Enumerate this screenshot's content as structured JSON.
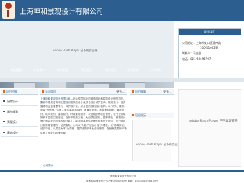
{
  "header": {
    "company_name": "上海坤和景观设计有限公司"
  },
  "banner": {
    "flash_notice": "Adobe Flash Player 已不再受支持"
  },
  "contact": {
    "title": "联系我们",
    "lines": [
      "公司地址：上海市虹口区通州路",
      "100号1002室",
      "联系人：马先生",
      "电话：021-26492767"
    ]
  },
  "nav": {
    "items": [
      "网站首页",
      "公司简介",
      "项目列表",
      "项目展示",
      "资质证书",
      "在线留言",
      "人才招聘"
    ]
  },
  "sidebar": {
    "title": "项目列表",
    "items": [
      "厨房设计",
      "城市规划",
      "景观设计",
      "建筑设计"
    ]
  },
  "about": {
    "title": "公司简介",
    "more": "更多...",
    "company_name": "上海坤和景观设计有限公司",
    "text": "—综合性国际化的城市规划和建筑设计研究机构，集城市规划咨询和工程设计服务的设计及综合设计研究咨询、规划设计、投资管理和运营管理等为一体的现代化、综合性的规划设计机构。以\"研究、服务、质量\"为宗旨，公司主要从事城市规划、风景区规划、旅游策划规划、景观设计、城市规划、建筑设计、环境景观设计、农业规划等项目设计，在行业领域拥有丰富的实践经验，在城市规划方面、大型项目规划、园林绿化、景观设计等方面表现出较强的设计能力，能为顾客提供全面的规划设计服务，可行使设计和策略管理的一站式服务。公司以\"为客户创造价值\"为理念，以\"求真务实、诚实守信、以质量为本\"为原则，提供优质的专业咨询服务，在竞争激烈的市场中树立良好的品牌形象。",
    "link": "公司简介"
  },
  "project_search": {
    "title": "项目搜索",
    "more": "更多..."
  },
  "project_showcase": {
    "title": "项目展示",
    "flash_notice": "Adobe Flash Player 已不再受支持"
  },
  "right_flash": {
    "flash_notice": "Adobe Flash Player 已不再受支持"
  },
  "footer": {
    "company": "上海坤和景观设计有限公司",
    "icp": "技术支持 备案号:沪ICP备09000050号 邮箱：1001001@163.com"
  },
  "colors": {
    "primary": "#2c5f8f",
    "accent_bullet": "#e06a1a"
  }
}
